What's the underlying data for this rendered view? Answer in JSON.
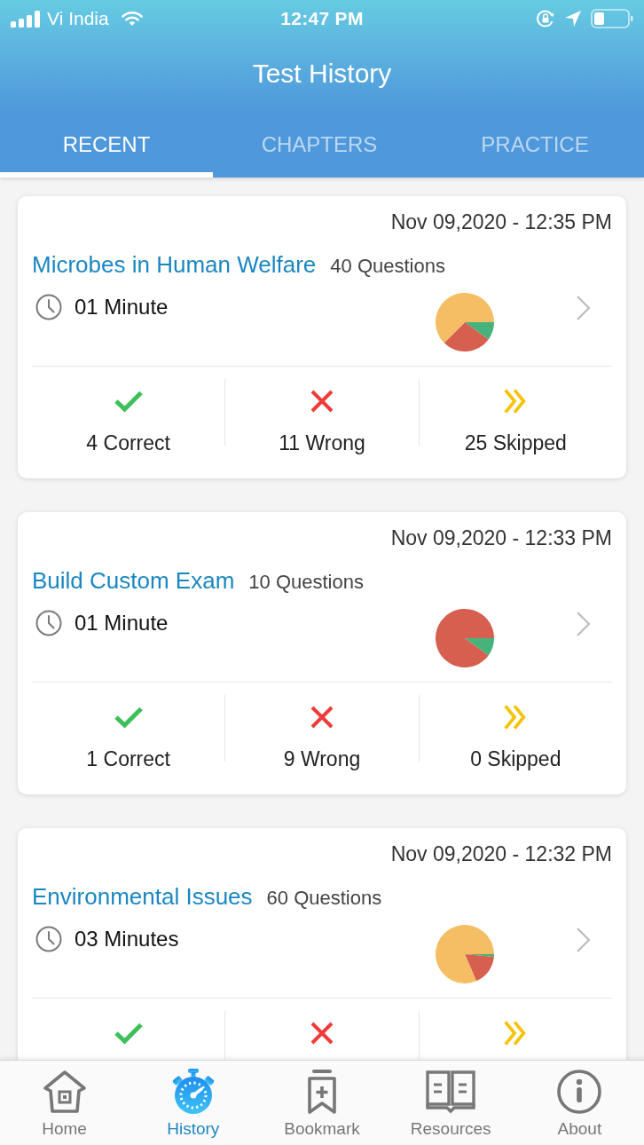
{
  "status_bar": {
    "carrier": "Vi India",
    "time": "12:47 PM"
  },
  "header": {
    "title": "Test History"
  },
  "tabs": [
    {
      "label": "RECENT",
      "selected": true
    },
    {
      "label": "CHAPTERS",
      "selected": false
    },
    {
      "label": "PRACTICE",
      "selected": false
    }
  ],
  "tests": [
    {
      "date": "Nov 09,2020 - 12:35 PM",
      "title": "Microbes in Human Welfare",
      "questions": "40 Questions",
      "duration": "01 Minute",
      "chart_data": {
        "type": "pie",
        "values": [
          10,
          27.5,
          62.5
        ]
      },
      "stats": [
        {
          "kind": "correct",
          "label": "4 Correct"
        },
        {
          "kind": "wrong",
          "label": "11 Wrong"
        },
        {
          "kind": "skipped",
          "label": "25 Skipped"
        }
      ]
    },
    {
      "date": "Nov 09,2020 - 12:33 PM",
      "title": "Build Custom Exam",
      "questions": "10 Questions",
      "duration": "01 Minute",
      "chart_data": {
        "type": "pie",
        "values": [
          10,
          90,
          0
        ]
      },
      "stats": [
        {
          "kind": "correct",
          "label": "1 Correct"
        },
        {
          "kind": "wrong",
          "label": "9 Wrong"
        },
        {
          "kind": "skipped",
          "label": "0 Skipped"
        }
      ]
    },
    {
      "date": "Nov 09,2020 - 12:32 PM",
      "title": "Environmental Issues",
      "questions": "60 Questions",
      "duration": "03 Minutes",
      "stats": [
        {
          "kind": "correct"
        },
        {
          "kind": "wrong"
        },
        {
          "kind": "skipped"
        }
      ]
    }
  ],
  "bottom_nav": [
    {
      "label": "Home",
      "selected": false
    },
    {
      "label": "History",
      "selected": true
    },
    {
      "label": "Bookmark",
      "selected": false
    },
    {
      "label": "Resources",
      "selected": false
    },
    {
      "label": "About",
      "selected": false
    }
  ]
}
